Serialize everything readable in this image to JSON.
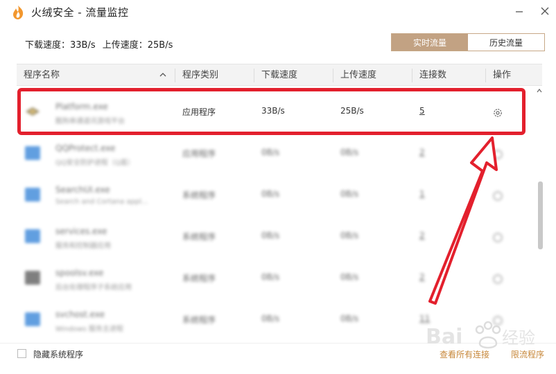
{
  "window": {
    "title": "火绒安全 - 流量监控",
    "minimize_icon": "minimize-icon",
    "close_icon": "close-icon"
  },
  "summary": {
    "download_label": "下载速度：33B/s",
    "upload_label": "上传速度：25B/s"
  },
  "tabs": [
    {
      "label": "实时流量",
      "active": true
    },
    {
      "label": "历史流量",
      "active": false
    }
  ],
  "table": {
    "headers": [
      "程序名称",
      "程序类别",
      "下载速度",
      "上传速度",
      "连接数",
      "操作"
    ],
    "rows": [
      {
        "name": "Platform.exe",
        "desc": "酷狗串通道讯游戏平台",
        "category": "应用程序",
        "down": "33B/s",
        "up": "25B/s",
        "conn": "5",
        "blurred": false
      },
      {
        "name": "QQProtect.exe",
        "desc": "QQ安全防护进程（Q盾）",
        "category": "应用程序",
        "down": "0B/s",
        "up": "0B/s",
        "conn": "2",
        "blurred": true
      },
      {
        "name": "SearchUI.exe",
        "desc": "Search and Cortana appl...",
        "category": "系统程序",
        "down": "0B/s",
        "up": "0B/s",
        "conn": "1",
        "blurred": true
      },
      {
        "name": "services.exe",
        "desc": "服务和控制器应用",
        "category": "系统程序",
        "down": "0B/s",
        "up": "0B/s",
        "conn": "2",
        "blurred": true
      },
      {
        "name": "spoolsv.exe",
        "desc": "后台处理程序子系统应用",
        "category": "系统程序",
        "down": "0B/s",
        "up": "0B/s",
        "conn": "2",
        "blurred": true
      },
      {
        "name": "svchost.exe",
        "desc": "Windows 服务主进程",
        "category": "系统程序",
        "down": "0B/s",
        "up": "0B/s",
        "conn": "11",
        "blurred": true
      }
    ]
  },
  "footer": {
    "hide_system_label": "隐藏系统程序",
    "view_all_link": "查看所有连接",
    "limit_link": "限流程序"
  },
  "colors": {
    "accent": "#c2a283",
    "highlight": "#e3202d",
    "link": "#c7873a"
  }
}
